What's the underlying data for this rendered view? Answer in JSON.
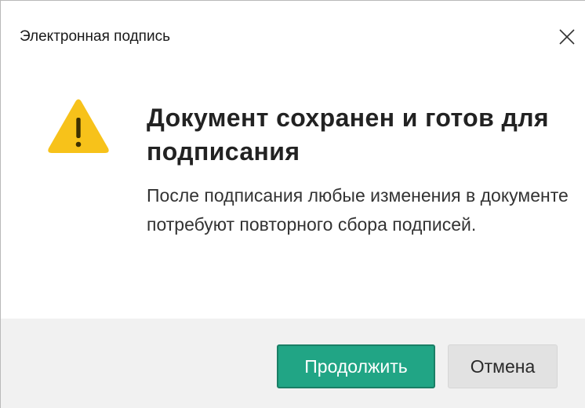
{
  "window": {
    "title": "Электронная подпись",
    "close_icon": "close-icon"
  },
  "content": {
    "icon": "warning-icon",
    "icon_color": "#f7c21a",
    "heading": "Документ сохранен и готов для подписания",
    "message": "После подписания любые изменения в документе потребуют повторного сбора подписей."
  },
  "footer": {
    "continue_label": "Продолжить",
    "cancel_label": "Отмена",
    "primary_color": "#21a585"
  }
}
